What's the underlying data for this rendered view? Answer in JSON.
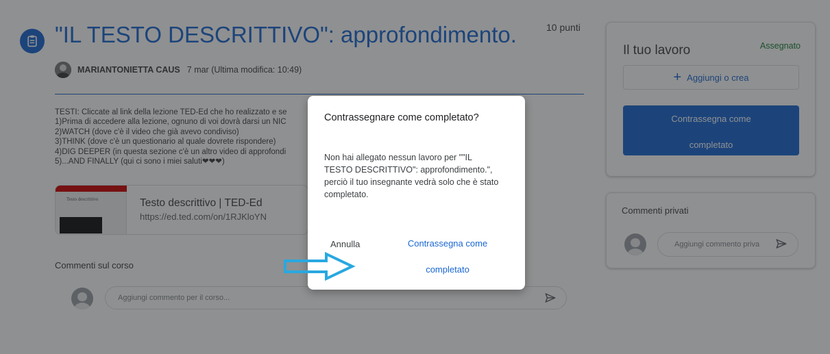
{
  "assignment": {
    "title": "\"IL TESTO DESCRITTIVO\": approfondimento.",
    "points": "10 punti",
    "author": "MARIANTONIETTA CAUS",
    "date": "7 mar (Ultima modifica: 10:49)",
    "description": "TESTI: Cliccate al link della lezione TED-Ed che ho realizzato e se\n1)Prima di accedere alla lezione, ognuno di voi dovrà darsi un NIC\n2)WATCH (dove c'è il video che già avevo condiviso)\n3)THINK (dove c'è un questionario al quale dovrete rispondere)\n4)DIG DEEPER (in questa sezione c'è un altro video di approfondi\n5)...AND FINALLY (qui ci sono i miei saluti❤❤❤)",
    "attachment": {
      "title": "Testo descrittivo | TED-Ed",
      "url": "https://ed.ted.com/on/1RJKloYN",
      "thumb_title": "Testo descrittivo"
    }
  },
  "class_comments": {
    "heading": "Commenti sul corso",
    "placeholder": "Aggiungi commento per il corso..."
  },
  "your_work": {
    "title": "Il tuo lavoro",
    "status": "Assegnato",
    "add_label": "Aggiungi o crea",
    "mark_line1": "Contrassegna come",
    "mark_line2": "completato"
  },
  "private_comments": {
    "title": "Commenti privati",
    "placeholder": "Aggiungi commento priva"
  },
  "dialog": {
    "title": "Contrassegnare come completato?",
    "body": "Non hai allegato nessun lavoro per \"\"IL TESTO DESCRITTIVO\": approfondimento.\", perciò il tuo insegnante vedrà solo che è stato completato.",
    "cancel": "Annulla",
    "confirm_line1": "Contrassegna come",
    "confirm_line2": "completato"
  },
  "colors": {
    "primary": "#1967d2",
    "assigned_green": "#188038",
    "annotation_arrow": "#29a8e0"
  },
  "icons": [
    "assignment-icon",
    "plus-icon",
    "send-icon",
    "arrow-annotation-icon"
  ]
}
